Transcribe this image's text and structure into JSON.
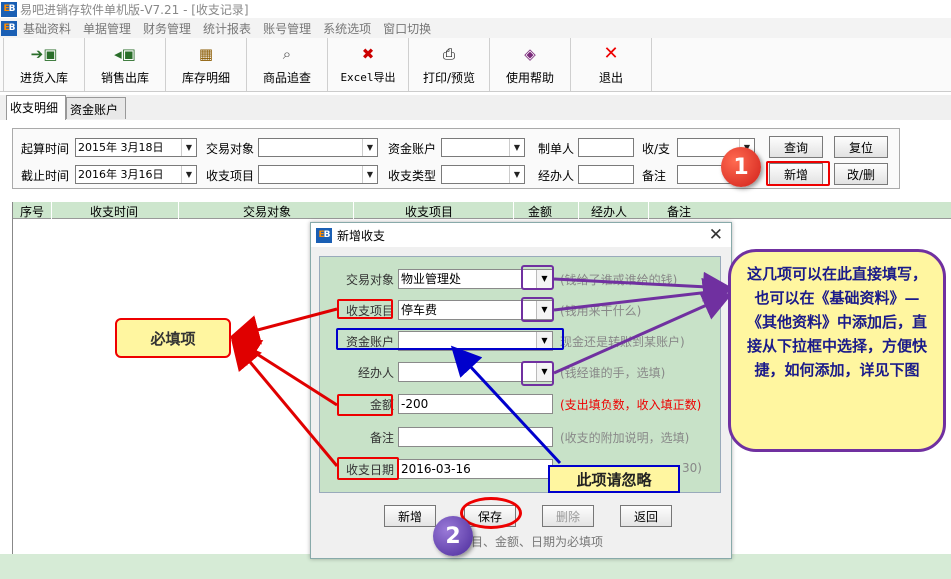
{
  "app": {
    "title": "易吧进销存软件单机版-V7.21 - [收支记录]",
    "logo": "EB"
  },
  "menu": [
    "基础资料",
    "单据管理",
    "财务管理",
    "统计报表",
    "账号管理",
    "系统选项",
    "窗口切换"
  ],
  "toolbar": [
    {
      "label": "进货入库",
      "icon": "stock-in-icon"
    },
    {
      "label": "销售出库",
      "icon": "sale-out-icon"
    },
    {
      "label": "库存明细",
      "icon": "inventory-icon"
    },
    {
      "label": "商品追查",
      "icon": "product-trace-icon"
    },
    {
      "label": "Excel导出",
      "icon": "excel-export-icon"
    },
    {
      "label": "打印/预览",
      "icon": "print-icon"
    },
    {
      "label": "使用帮助",
      "icon": "help-icon"
    },
    {
      "label": "退出",
      "icon": "exit-icon"
    }
  ],
  "tabs": [
    "收支明细",
    "资金账户"
  ],
  "filter": {
    "start_label": "起算时间",
    "start_value": "2015年 3月18日",
    "end_label": "截止时间",
    "end_value": "2016年 3月16日",
    "party_label": "交易对象",
    "item_label": "收支项目",
    "account_label": "资金账户",
    "type_label": "收支类型",
    "maker_label": "制单人",
    "handler_label": "经办人",
    "inout_label": "收/支",
    "remark_label": "备注",
    "query_button": "查询",
    "reset_button": "复位",
    "add_button": "新增",
    "edit_button": "改/删"
  },
  "grid": {
    "columns": [
      "序号",
      "收支时间",
      "交易对象",
      "收支项目",
      "金额",
      "经办人",
      "备注"
    ]
  },
  "dialog": {
    "title": "新增收支",
    "fields": [
      {
        "label": "交易对象",
        "value": "物业管理处",
        "hint": "(钱给了谁或谁给的钱)",
        "dropdown": true
      },
      {
        "label": "收支项目",
        "value": "停车费",
        "hint": "(钱用来干什么)",
        "dropdown": true
      },
      {
        "label": "资金账户",
        "value": "",
        "hint": "现金还是转账到某账户)",
        "dropdown": true
      },
      {
        "label": "经办人",
        "value": "",
        "hint": "(钱经谁的手，选填)",
        "dropdown": true
      },
      {
        "label": "金额",
        "value": "-200",
        "hint": "(支出填负数，收入填正数)",
        "dropdown": false
      },
      {
        "label": "备注",
        "value": "",
        "hint": "(收支的附加说明，选填)",
        "dropdown": false
      },
      {
        "label": "收支日期",
        "value": "2016-03-16",
        "hint": "30)",
        "dropdown": false
      }
    ],
    "buttons": {
      "add": "新增",
      "save": "保存",
      "delete": "删除",
      "back": "返回"
    },
    "note": "目、金额、日期为必填项"
  },
  "annotations": {
    "required": "必填项",
    "ignore": "此项请忽略",
    "tip": "这几项可以在此直接填写，也可以在《基础资料》—《其他资料》中添加后，直接从下拉框中选择，方便快捷，如何添加，详见下图",
    "step1": "1",
    "step2": "2"
  },
  "colors": {
    "accent_red": "#e00000",
    "purple": "#7030a0",
    "blue": "#0000cc",
    "note_yellow": "#fff6a0",
    "panel_green": "#c8e2c8"
  }
}
